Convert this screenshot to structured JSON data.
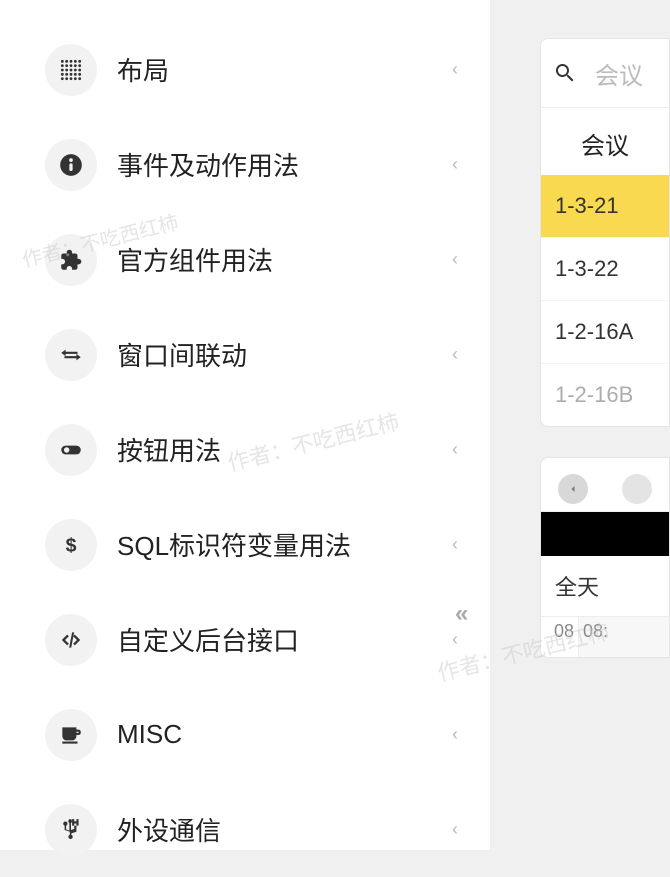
{
  "sidebar": {
    "items": [
      {
        "label": "布局",
        "icon": "grid"
      },
      {
        "label": "事件及动作用法",
        "icon": "info"
      },
      {
        "label": "官方组件用法",
        "icon": "puzzle"
      },
      {
        "label": "窗口间联动",
        "icon": "swap"
      },
      {
        "label": "按钮用法",
        "icon": "toggle"
      },
      {
        "label": "SQL标识符变量用法",
        "icon": "dollar"
      },
      {
        "label": "自定义后台接口",
        "icon": "code"
      },
      {
        "label": "MISC",
        "icon": "coffee"
      },
      {
        "label": "外设通信",
        "icon": "usb"
      }
    ]
  },
  "right": {
    "search_placeholder": "会议",
    "header": "会议",
    "rooms": [
      {
        "name": "1-3-21",
        "selected": true
      },
      {
        "name": "1-3-22",
        "selected": false
      },
      {
        "name": "1-2-16A",
        "selected": false
      },
      {
        "name": "1-2-16B",
        "selected": false
      }
    ],
    "allday": "全天",
    "hours": [
      "08",
      "08:"
    ]
  },
  "watermark": "作者：不吃西红柿"
}
